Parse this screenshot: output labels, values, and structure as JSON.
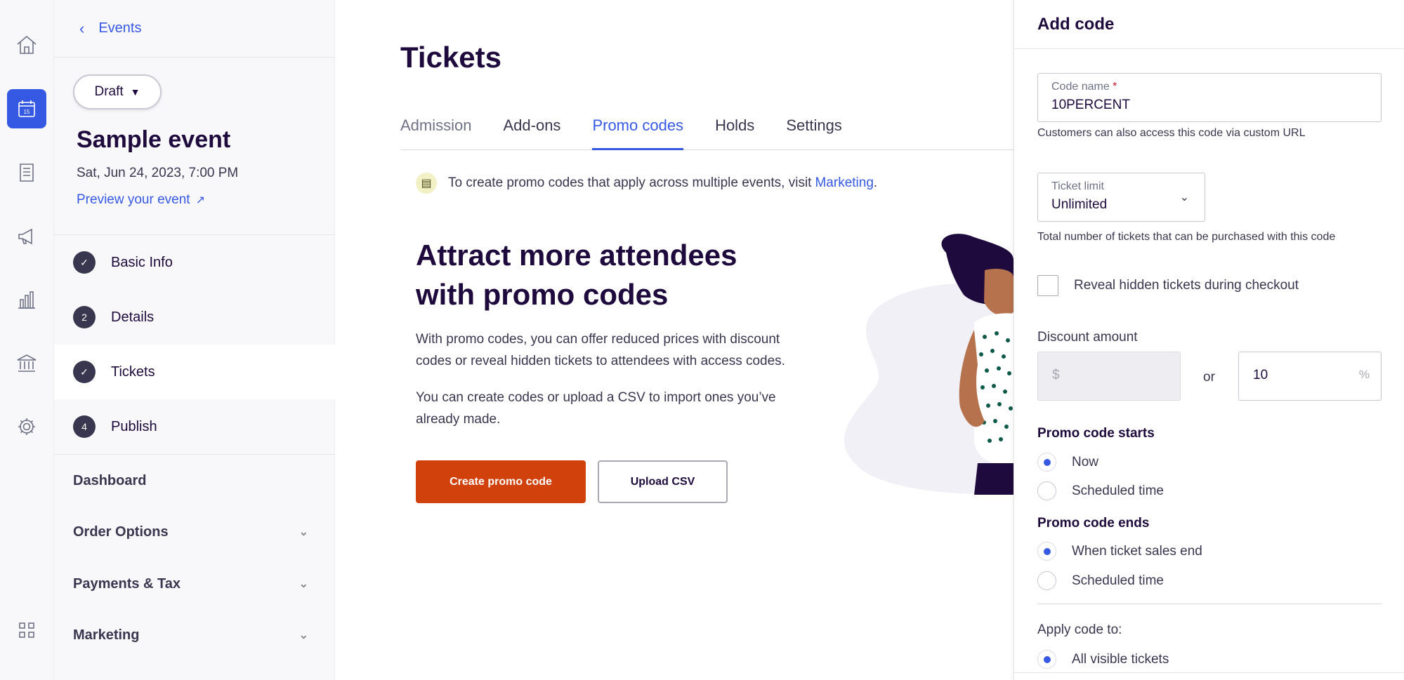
{
  "sidebar": {
    "back_label": "Events",
    "status_pill": "Draft",
    "event_title": "Sample event",
    "event_date": "Sat, Jun 24, 2023, 7:00 PM",
    "preview_link": "Preview your event",
    "steps": [
      {
        "badge": "✓",
        "label": "Basic Info",
        "active": false
      },
      {
        "badge": "2",
        "label": "Details",
        "active": false
      },
      {
        "badge": "✓",
        "label": "Tickets",
        "active": true
      },
      {
        "badge": "4",
        "label": "Publish",
        "active": false
      }
    ],
    "sections": [
      "Dashboard",
      "Order Options",
      "Payments & Tax",
      "Marketing"
    ]
  },
  "main": {
    "title": "Tickets",
    "tabs": [
      "Admission",
      "Add-ons",
      "Promo codes",
      "Holds",
      "Settings"
    ],
    "active_tab": "Promo codes",
    "notice_text": "To create promo codes that apply across multiple events, visit",
    "notice_link": "Marketing",
    "notice_end": ".",
    "hero_title": "Attract more attendees with promo codes",
    "hero_p1": "With promo codes, you can offer reduced prices with discount codes or reveal hidden tickets to attendees with access codes.",
    "hero_p2": "You can create codes or upload a CSV to import ones you’ve already made.",
    "create_button": "Create promo code",
    "upload_button": "Upload CSV"
  },
  "panel": {
    "title": "Add code",
    "code_name_label": "Code name",
    "code_name_value": "10PERCENT",
    "code_name_help": "Customers can also access this code via custom URL",
    "ticket_limit_label": "Ticket limit",
    "ticket_limit_value": "Unlimited",
    "ticket_limit_help": "Total number of tickets that can be purchased with this code",
    "reveal_hidden_label": "Reveal hidden tickets during checkout",
    "discount_label": "Discount amount",
    "currency_symbol": "$",
    "or_label": "or",
    "percent_value": "10",
    "percent_symbol": "%",
    "starts_label": "Promo code starts",
    "starts_options": [
      "Now",
      "Scheduled time"
    ],
    "ends_label": "Promo code ends",
    "ends_options": [
      "When ticket sales end",
      "Scheduled time"
    ],
    "apply_label": "Apply code to:",
    "apply_options": [
      "All visible tickets"
    ]
  },
  "icons": {
    "rail": [
      "home-icon",
      "calendar-icon",
      "orders-icon",
      "megaphone-icon",
      "analytics-icon",
      "finance-icon",
      "settings-icon",
      "apps-icon"
    ],
    "calendar_day": "15"
  },
  "colors": {
    "accent": "#3659e3",
    "primary_button": "#d1410c",
    "text": "#1e0a3c",
    "sidebar_bg": "#f8f7fa"
  }
}
